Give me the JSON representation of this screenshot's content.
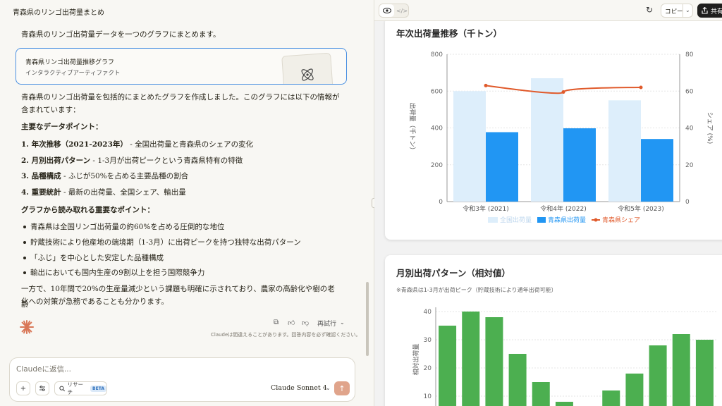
{
  "conversation": {
    "title": "青森県のリンゴ出荷量まとめ"
  },
  "message": {
    "intro": "青森県のリンゴ出荷量データを一つのグラフにまとめます。",
    "artifact": {
      "title": "青森県リンゴ出荷量推移グラフ",
      "subtitle": "インタラクティブアーティファクト"
    },
    "summary_line1": "青森県のリンゴ出荷量を包括的にまとめたグラフを作成しました。このグラフには以下の情報が",
    "summary_line2": "含まれています：",
    "datapoints_heading": "主要なデータポイント：",
    "datapoints": [
      {
        "bold": "1. 年次推移（2021-2023年）",
        "text": " - 全国出荷量と青森県のシェアの変化"
      },
      {
        "bold": "2. 月別出荷パターン",
        "text": " - 1-3月が出荷ピークという青森県特有の特徴"
      },
      {
        "bold": "3. 品種構成",
        "text": " - ふじが50%を占める主要品種の割合"
      },
      {
        "bold": "4. 重要統計",
        "text": " - 最新の出荷量、全国シェア、輸出量"
      }
    ],
    "insights_heading": "グラフから読み取れる重要なポイント：",
    "insights": [
      "青森県は全国リンゴ出荷量の約60%を占める圧倒的な地位",
      "貯蔵技術により他産地の端境期（1-3月）に出荷ピークを持つ独特な出荷パターン",
      "「ふじ」を中心とした安定した品種構成",
      "輸出においても国内生産の9割以上を担う国際競争力"
    ],
    "closing_line1": "一方で、10年間で20%の生産量減少という課題も明確に示されており、農家の高齢化や樹の老齢",
    "closing_line2": "化への対策が急務であることも分かります。",
    "retry_label": "再試行",
    "disclaimer": "Claudeは間違えることがあります。回答内容を必ず確認ください。"
  },
  "input": {
    "placeholder": "Claudeに返信...",
    "research_label": "リサーチ",
    "beta_badge": "BETA",
    "model_label": "Claude Sonnet 4"
  },
  "toolbar": {
    "copy_label": "コピー",
    "share_label": "共有"
  },
  "icons": [
    "chevron-down-icon",
    "claude-icon",
    "copy-icon",
    "thumbs-up-icon",
    "thumbs-down-icon",
    "plus-icon",
    "sliders-icon",
    "search-icon",
    "arrow-up-icon",
    "eye-icon",
    "code-icon",
    "refresh-icon",
    "share-icon",
    "atom-icon"
  ],
  "colors": {
    "national": "#ddeefb",
    "aomori": "#2196f3",
    "share": "#e05a2b",
    "monthly": "#4caf50",
    "accent": "#4a90e2"
  },
  "chart_data": [
    {
      "type": "bar",
      "title": "年次出荷量推移（千トン）",
      "categories": [
        "令和3年 (2021)",
        "令和4年 (2022)",
        "令和5年 (2023)"
      ],
      "series": [
        {
          "name": "全国出荷量",
          "type": "bar",
          "axis": "left",
          "values": [
            600,
            670,
            550
          ]
        },
        {
          "name": "青森県出荷量",
          "type": "bar",
          "axis": "left",
          "values": [
            377,
            398,
            340
          ]
        },
        {
          "name": "青森県シェア",
          "type": "line",
          "axis": "right",
          "values": [
            63,
            59.5,
            62
          ]
        }
      ],
      "ylabel": "出荷量（千トン）",
      "ylabel_right": "シェア (%)",
      "ylim": [
        0,
        800
      ],
      "yticks": [
        0,
        200,
        400,
        600,
        800
      ],
      "ylim_right": [
        0,
        80
      ],
      "yticks_right": [
        0,
        20,
        40,
        60,
        80
      ],
      "legend": "bottom",
      "grid": true
    },
    {
      "type": "bar",
      "title": "月別出荷パターン（相対値）",
      "note": "※青森県は1-3月が出荷ピーク（貯蔵技術により通年出荷可能）",
      "values": [
        35,
        40,
        38,
        25,
        15,
        8,
        null,
        12,
        18,
        28,
        32,
        30
      ],
      "ylabel": "相対出荷量",
      "ylim": [
        0,
        40
      ],
      "yticks": [
        10,
        20,
        30,
        40
      ],
      "grid": true
    }
  ]
}
